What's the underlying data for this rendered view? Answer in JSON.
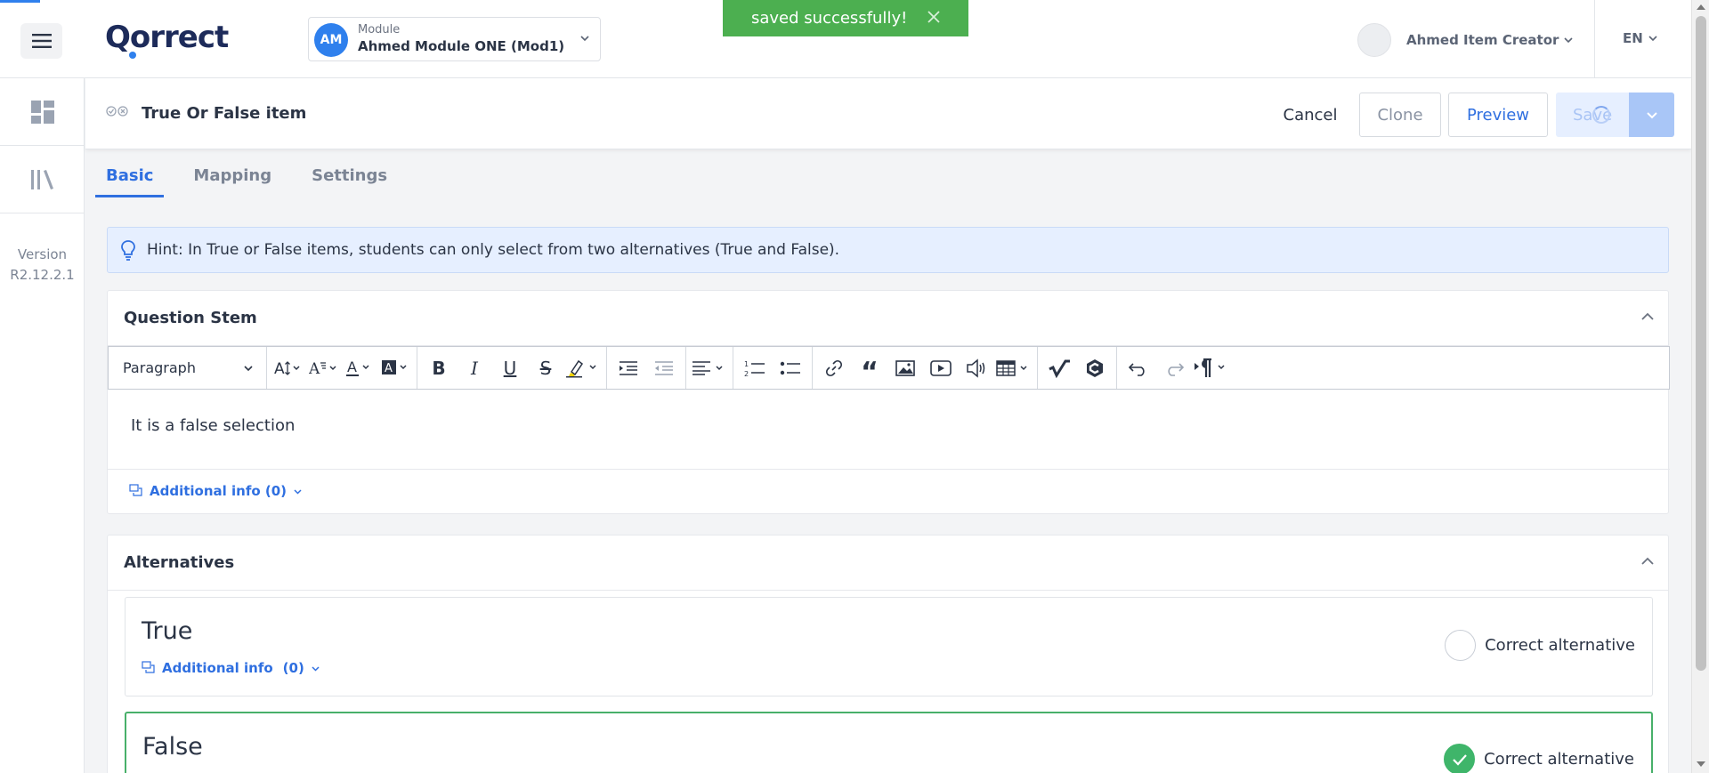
{
  "app": {
    "logo": "Qorrect",
    "brand_color": "#2f80ed"
  },
  "module": {
    "avatar": "AM",
    "label": "Module",
    "value": "Ahmed Module ONE (Mod1)"
  },
  "toast": {
    "message": "saved successfully!",
    "color": "#4caf50"
  },
  "user": {
    "name": "Ahmed Item Creator"
  },
  "language": "EN",
  "sidebar": {
    "version_label": "Version",
    "version": "R2.12.2.1"
  },
  "item": {
    "title": "True Or False item",
    "actions": {
      "cancel": "Cancel",
      "clone": "Clone",
      "preview": "Preview",
      "save": "Save"
    }
  },
  "tabs": [
    "Basic",
    "Mapping",
    "Settings"
  ],
  "hint": "Hint: In True or False items, students can only select from two alternatives (True and False).",
  "question_stem": {
    "title": "Question Stem",
    "paragraph_select": "Paragraph",
    "content": "It is a false selection",
    "additional_info": "Additional info (0)"
  },
  "alternatives": {
    "title": "Alternatives",
    "items": [
      {
        "name": "True",
        "additional_info": "Additional info",
        "count": "(0)",
        "correct_label": "Correct alternative",
        "correct": false
      },
      {
        "name": "False",
        "correct_label": "Correct alternative",
        "correct": true
      }
    ]
  }
}
